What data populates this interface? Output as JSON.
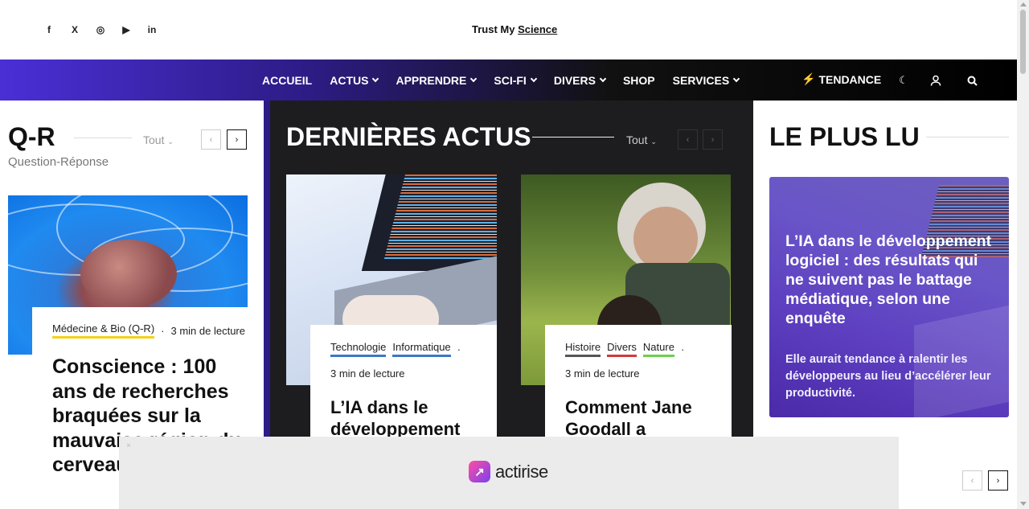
{
  "site": {
    "name_part1": "Trust My",
    "name_part2": "Science"
  },
  "social": [
    {
      "icon": "facebook-icon",
      "glyph": "f"
    },
    {
      "icon": "x-icon",
      "glyph": "X"
    },
    {
      "icon": "instagram-icon",
      "glyph": "◎"
    },
    {
      "icon": "youtube-icon",
      "glyph": "▶"
    },
    {
      "icon": "linkedin-icon",
      "glyph": "in"
    }
  ],
  "nav": {
    "items": [
      "ACCUEIL",
      "ACTUS",
      "APPRENDRE",
      "SCI-FI",
      "DIVERS",
      "SHOP",
      "SERVICES"
    ],
    "trend": "TENDANCE",
    "trend_icon": "⚡",
    "icons": {
      "theme": "☾",
      "user": "👤",
      "search": "⌕"
    }
  },
  "qr": {
    "title": "Q-R",
    "subtitle": "Question-Réponse",
    "filter": "Tout",
    "article": {
      "category": "Médecine & Bio (Q-R)",
      "category_color": "#f5d215",
      "readtime": "3 min de lecture",
      "headline": "Conscience : 100 ans de recherches braquées sur la mauvaise région du cerveau"
    }
  },
  "latest": {
    "title": "DERNIÈRES ACTUS",
    "filter": "Tout",
    "articles": [
      {
        "tags": [
          {
            "label": "Technologie",
            "color": "#3a78c9"
          },
          {
            "label": "Informatique",
            "color": "#3a78c9"
          }
        ],
        "readtime": "3 min de lecture",
        "headline": "L’IA dans le développement"
      },
      {
        "tags": [
          {
            "label": "Histoire",
            "color": "#555555"
          },
          {
            "label": "Divers",
            "color": "#d23a3a"
          },
          {
            "label": "Nature",
            "color": "#6ad04a"
          }
        ],
        "readtime": "3 min de lecture",
        "headline": "Comment Jane Goodall a"
      }
    ]
  },
  "popular": {
    "title": "LE PLUS LU",
    "featured": {
      "headline": "L’IA dans le développement logiciel : des résultats qui ne suivent pas le battage médiatique, selon une enquête",
      "description": "Elle aurait tendance à ralentir les développeurs au lieu d’accélérer leur productivité."
    }
  },
  "ad": {
    "brand": "actirise",
    "close": "×"
  },
  "pager": {
    "prev": "‹",
    "next": "›"
  },
  "colors": {
    "accent": "#4a2fd6",
    "dark_panel": "#1d1d1f"
  }
}
